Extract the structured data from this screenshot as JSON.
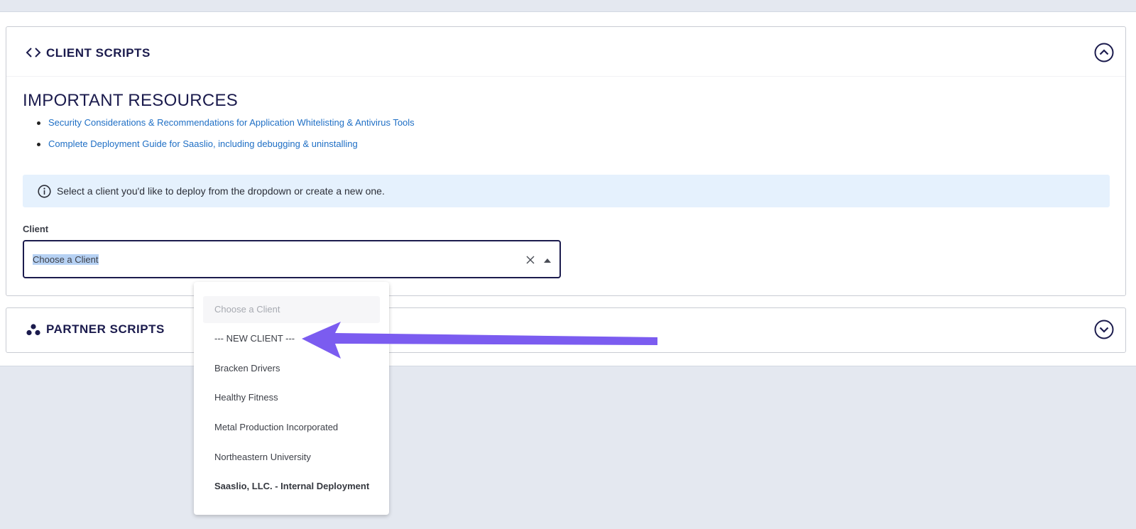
{
  "client_scripts": {
    "title": "CLIENT SCRIPTS",
    "icon": "code-icon",
    "toggle_icon": "chevron-up-circle-icon"
  },
  "resources": {
    "title": "IMPORTANT RESOURCES",
    "links": [
      "Security Considerations & Recommendations for Application Whitelisting & Antivirus Tools",
      "Complete Deployment Guide for Saaslio, including debugging & uninstalling"
    ]
  },
  "info": {
    "icon": "info-circle-icon",
    "text": "Select a client you'd like to deploy from the dropdown or create a new one."
  },
  "client_field": {
    "label": "Client",
    "value": "Choose a Client"
  },
  "dropdown": {
    "options": [
      "Choose a Client",
      "--- NEW CLIENT ---",
      "Bracken Drivers",
      "Healthy Fitness",
      "Metal Production Incorporated",
      "Northeastern University",
      "Saaslio, LLC. - Internal Deployment"
    ]
  },
  "partner_scripts": {
    "title": "PARTNER SCRIPTS",
    "icon": "partner-dots-icon",
    "toggle_icon": "chevron-down-circle-icon"
  },
  "colors": {
    "heading": "#1b1b4d",
    "link": "#1f6fc5",
    "info_bg": "#e5f1fd",
    "annotation_arrow": "#7b5cf0"
  }
}
